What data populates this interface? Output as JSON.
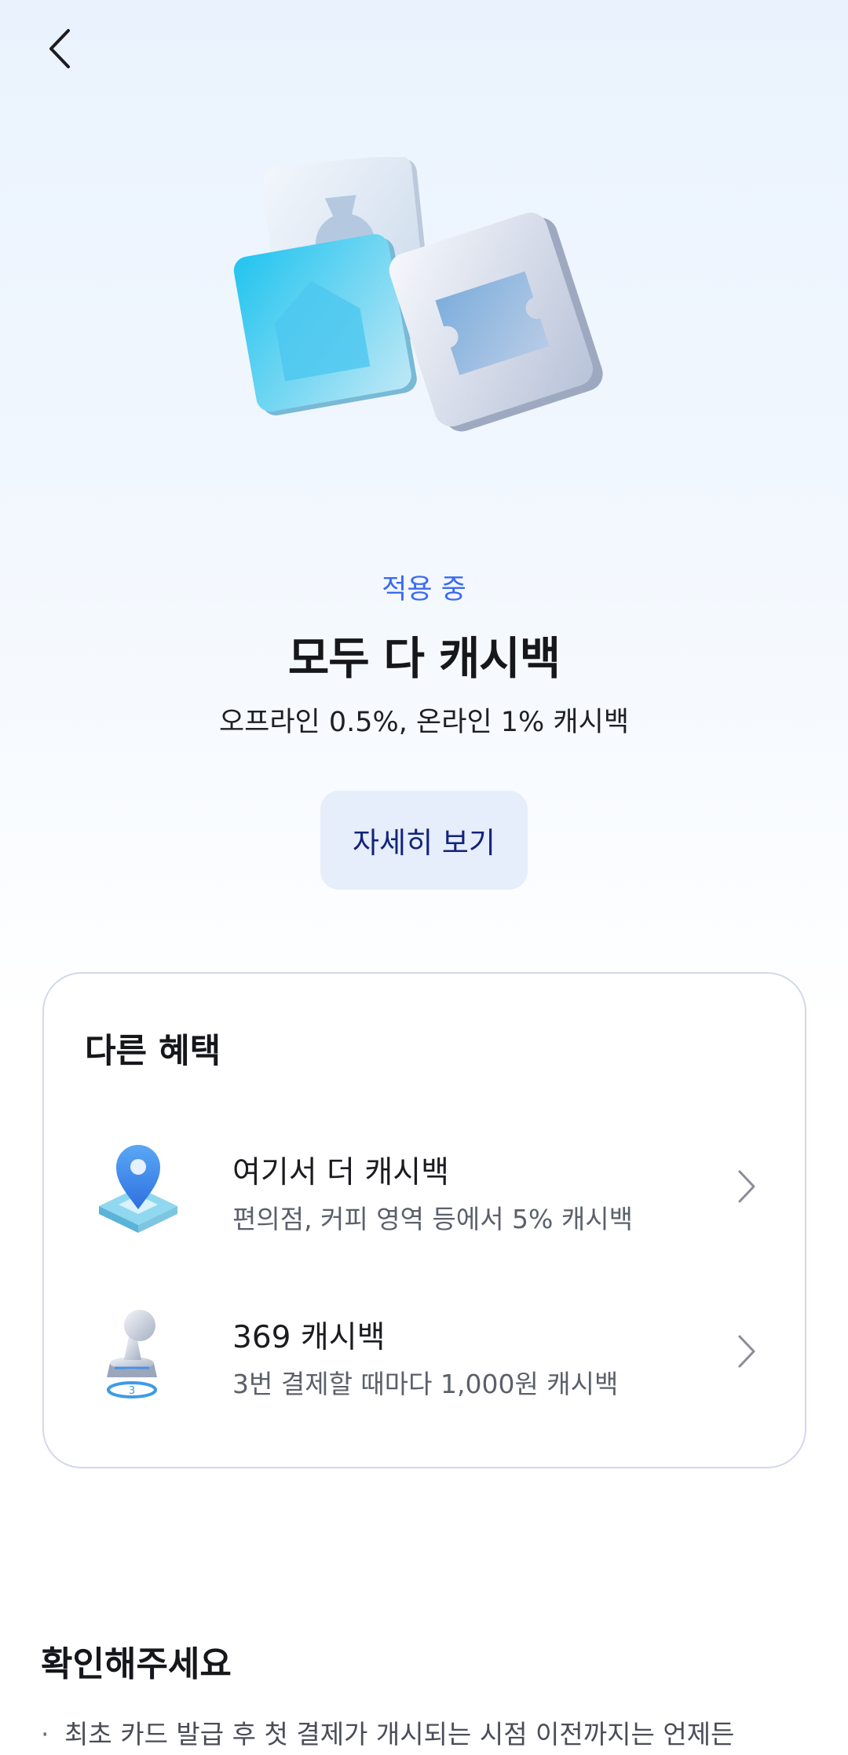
{
  "header": {
    "back_icon": "chevron-left-icon"
  },
  "hero": {
    "icon": "benefit-cards-illustration"
  },
  "benefit_main": {
    "status": "적용 중",
    "title": "모두 다 캐시백",
    "subtitle": "오프라인 0.5%, 온라인 1% 캐시백",
    "detail_button": "자세히 보기"
  },
  "other_benefits": {
    "title": "다른 혜택",
    "items": [
      {
        "title": "여기서 더 캐시백",
        "desc": "편의점, 커피 영역 등에서 5% 캐시백",
        "icon": "location-pin-icon"
      },
      {
        "title": "369 캐시백",
        "desc": "3번 결제할 때마다 1,000원 캐시백",
        "icon": "stamp-icon"
      }
    ]
  },
  "notice": {
    "title": "확인해주세요",
    "items": [
      "최초 카드 발급 후 첫 결제가 개시되는 시점 이전까지는 언제든"
    ]
  },
  "colors": {
    "accent": "#3b6cf0",
    "button_bg": "#e6edfb",
    "button_text": "#13237a"
  }
}
